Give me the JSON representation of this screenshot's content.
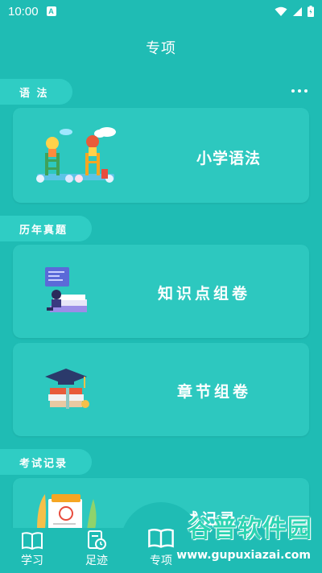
{
  "status_bar": {
    "time": "10:00",
    "badge": "A",
    "icons": [
      "wifi-icon",
      "signal-icon",
      "battery-icon"
    ]
  },
  "header": {
    "title": "专项"
  },
  "sections": {
    "grammar": {
      "tag": "语 法",
      "cards": [
        {
          "label": "小学语法",
          "icon": "kids-painting-illustration"
        }
      ]
    },
    "past_exams": {
      "tag": "历年真题",
      "cards": [
        {
          "label": "知识点组卷",
          "icon": "student-reading-books-illustration"
        },
        {
          "label": "章节组卷",
          "icon": "graduation-cap-books-illustration"
        }
      ]
    },
    "exam_records": {
      "tag": "考试记录",
      "cards": [
        {
          "label": "考试记录",
          "icon": "exam-paper-illustration"
        }
      ]
    }
  },
  "bottom_nav": {
    "items": [
      {
        "label": "学习",
        "icon": "book-icon"
      },
      {
        "label": "足迹",
        "icon": "footprint-clock-icon"
      },
      {
        "label": "专项",
        "icon": "open-book-icon",
        "active": true
      }
    ]
  },
  "watermark": {
    "title": "谷普软件园",
    "url": "www.gupuxiazai.com"
  },
  "colors": {
    "background": "#1fbcb4",
    "card": "#2dc8bf",
    "tag": "#2fcdc4",
    "text": "#ffffff"
  }
}
